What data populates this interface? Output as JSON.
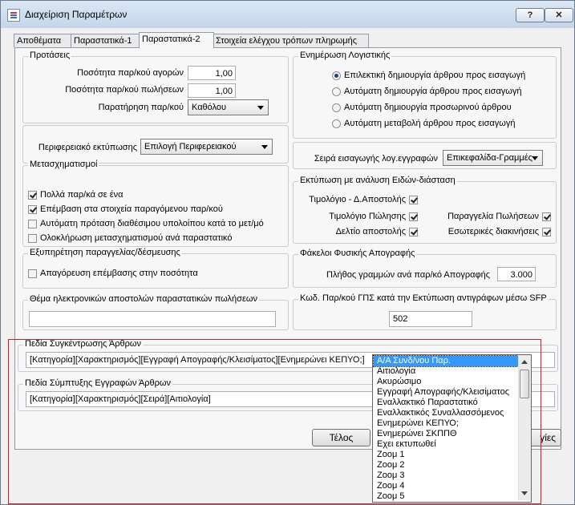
{
  "window": {
    "title": "Διαχείριση Παραμέτρων",
    "help_label": "?",
    "close_label": "✕"
  },
  "tabs": [
    "Αποθέματα",
    "Παραστατικά-1",
    "Παραστατικά-2",
    "Στοιχεία ελέγχου τρόπων πληρωμής"
  ],
  "active_tab": "Παραστατικά-2",
  "proposals": {
    "title": "Προτάσεις",
    "buy_qty_label": "Ποσότητα παρ/κού αγορών",
    "buy_qty_value": "1,00",
    "sell_qty_label": "Ποσότητα παρ/κού πωλήσεων",
    "sell_qty_value": "1,00",
    "note_label": "Παρατήρηση παρ/κού",
    "note_value": "Καθόλου"
  },
  "peripheral": {
    "label": "Περιφερειακό εκτύπωσης",
    "value": "Επιλογή Περιφερειακού"
  },
  "transformations": {
    "title": "Μετασχηματισμοί",
    "options": [
      {
        "label": "Πολλά παρ/κά σε ένα",
        "checked": true
      },
      {
        "label": "Επέμβαση στα στοιχεία παραγόμενου παρ/κού",
        "checked": true
      },
      {
        "label": "Αυτόματη πρόταση διαθέσιμου υπολοίπου κατά το μετ/μό",
        "checked": false
      },
      {
        "label": "Ολοκλήρωση μετασχηματισμού ανά παραστατικό",
        "checked": false
      }
    ]
  },
  "order_service": {
    "title": "Εξυπηρέτηση παραγγελίας/δέσμευσης",
    "option_label": "Απαγόρευση επέμβασης στην ποσότητα",
    "checked": false
  },
  "email_subject": {
    "title": "Θέμα ηλεκτρονικών αποστολών παραστατικών πωλήσεων",
    "value": ""
  },
  "accounting": {
    "title": "Ενημέρωση Λογιστικής",
    "options": [
      {
        "label": "Επιλεκτική δημιουργία άρθρου προς εισαγωγή",
        "checked": true
      },
      {
        "label": "Αυτόματη δημιουργία άρθρου προς εισαγωγή",
        "checked": false
      },
      {
        "label": "Αυτόματη δημιουργία προσωρινού άρθρου",
        "checked": false
      },
      {
        "label": "Αυτόματη μεταβολή άρθρου προς εισαγωγή",
        "checked": false
      }
    ]
  },
  "entry_order": {
    "label": "Σειρά εισαγωγής λογ.εγγραφών",
    "value": "Επικεφαλίδα-Γραμμές"
  },
  "analysis_print": {
    "title": "Εκτύπωση με ανάλυση Ειδών-διάσταση",
    "items": [
      {
        "label": "Τιμολόγιο - Δ.Αποστολής",
        "checked": true
      },
      {
        "label": "Τιμολόγιο Πώλησης",
        "checked": true
      },
      {
        "label": "Δελτίο αποστολής",
        "checked": true
      },
      {
        "label": "Παραγγελία Πωλήσεων",
        "checked": true
      },
      {
        "label": "Εσωτερικές διακινήσεις",
        "checked": true
      }
    ]
  },
  "inventory_folders": {
    "title": "Φάκελοι Φυσικής Απογραφής",
    "label": "Πλήθος γραμμών ανά παρ/κό Απογραφής",
    "value": "3.000"
  },
  "gps_code": {
    "title": "Κωδ. Παρ/κού ΓΠΣ κατά την Εκτύπωση αντιγράφων μέσω SFP",
    "value": "502"
  },
  "consolidation_fields": {
    "title": "Πεδία Συγκέντρωσης Άρθρων",
    "value": "[Κατηγορία][Χαρακτηρισμός][Εγγραφή Απογραφής/Κλεισίματος][Ενημερώνει ΚΕΠΥΟ;]"
  },
  "compression_fields": {
    "title": "Πεδία Σύμπτυξης Εγγραφών Άρθρων",
    "value": "[Κατηγορία][Χαρακτηρισμός][Σειρά][Αιτιολογία]"
  },
  "buttons": {
    "ok": "Τέλος",
    "defaults_partial": "γίες"
  },
  "dropdown": {
    "items": [
      "Α/Α Συνδ/νου Παρ.",
      "Αιτιολογία",
      "Ακυρώσιμο",
      "Εγγραφή Απογραφής/Κλεισίματος",
      "Εναλλακτικό Παραστατικό",
      "Εναλλακτικός Συναλλασσόμενος",
      "Ενημερώνει ΚΕΠΥΟ;",
      "Ενημερώνει ΣΚΠΠΘ",
      "Εχει εκτυπωθεί",
      "Ζοομ 1",
      "Ζοομ 2",
      "Ζοομ 3",
      "Ζοομ 4",
      "Ζοομ 5"
    ],
    "selected_index": 0
  },
  "colors": {
    "selection": "#3399ff",
    "highlight_frame": "#d02020"
  }
}
